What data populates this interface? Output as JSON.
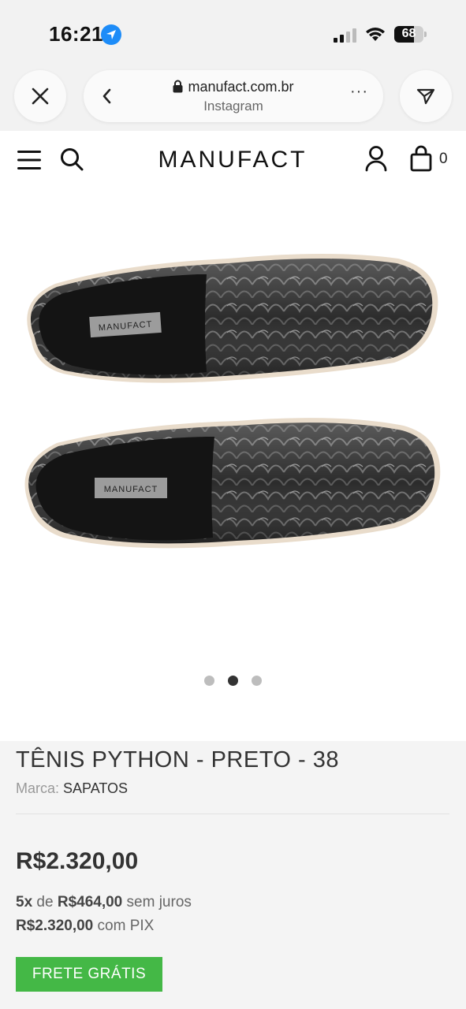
{
  "status_bar": {
    "time": "16:21",
    "battery": "68",
    "battery_level": 0.68
  },
  "browser": {
    "domain": "manufact.com.br",
    "source": "Instagram",
    "more": "···"
  },
  "site": {
    "logo": "MANUFACT",
    "cart_count": "0"
  },
  "product": {
    "label_text": "MANUFACT",
    "carousel": {
      "total": 3,
      "active_index": 1
    },
    "title": "TÊNIS PYTHON - PRETO - 38",
    "brand_label": "Marca:",
    "brand_value": "SAPATOS",
    "price": "R$2.320,00",
    "installments_count": "5x",
    "installments_de": "de",
    "installment_value": "R$464,00",
    "installments_suffix": "sem juros",
    "pix_price": "R$2.320,00",
    "pix_suffix": "com PIX",
    "shipping_badge": "FRETE GRÁTIS"
  },
  "colors": {
    "accent_green": "#44b846",
    "ios_blue": "#1d8cf8"
  }
}
